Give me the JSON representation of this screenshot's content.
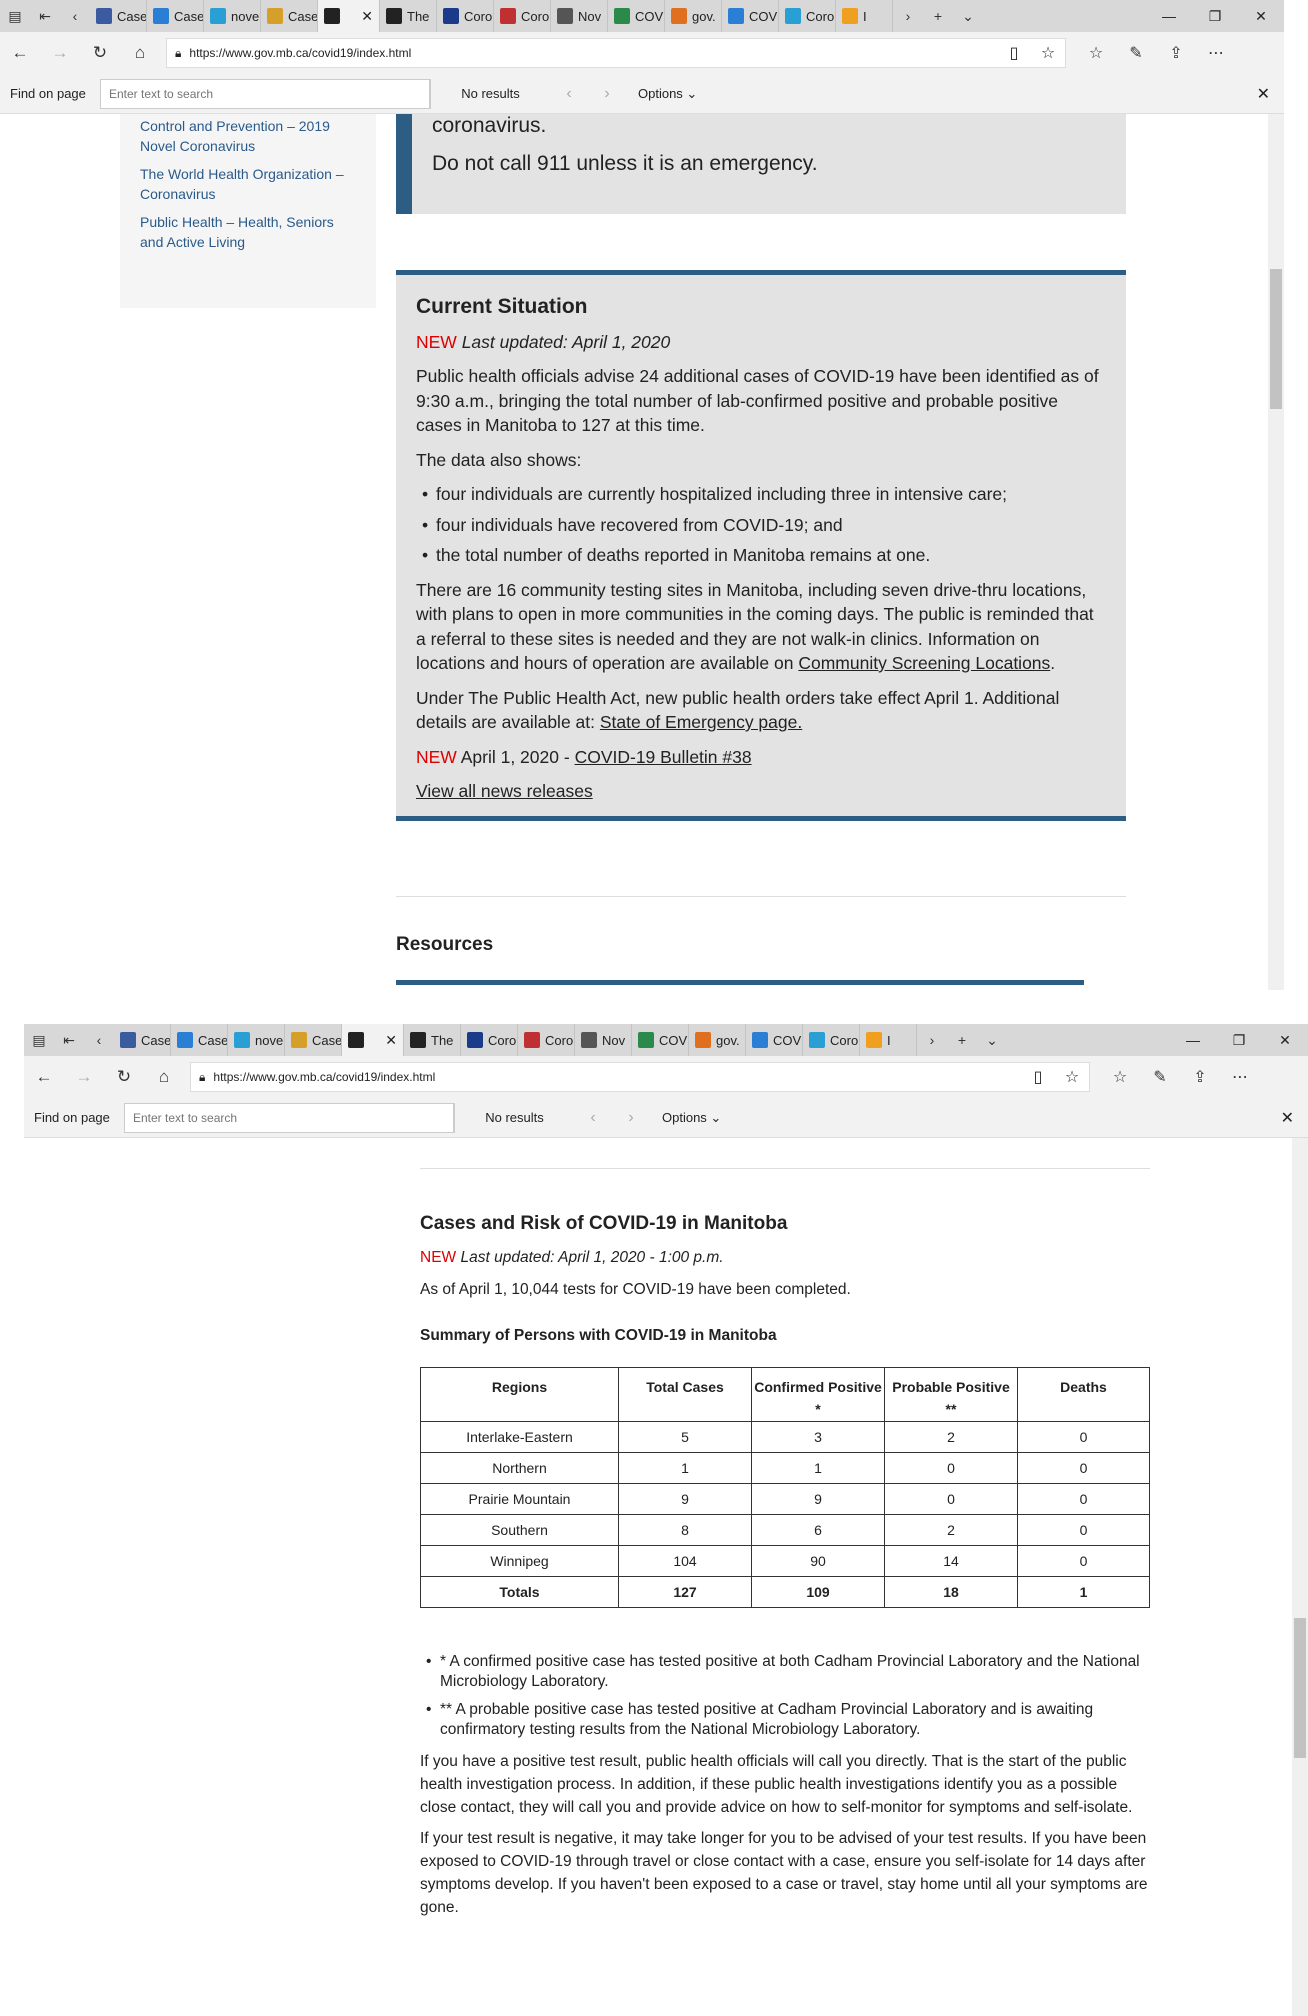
{
  "browser": {
    "tabs": [
      {
        "label": "Case",
        "icon": "cbc-icon",
        "color": "#3a5ba0"
      },
      {
        "label": "Case",
        "icon": "chart-icon",
        "color": "#2a7fd4"
      },
      {
        "label": "nove",
        "icon": "cross-icon",
        "color": "#2a9fd4"
      },
      {
        "label": "Case",
        "icon": "chart-icon",
        "color": "#d4a02a"
      },
      {
        "label": "",
        "icon": "arrow-icon",
        "color": "#222",
        "active": true
      },
      {
        "label": "The",
        "icon": "shield-icon",
        "color": "#222"
      },
      {
        "label": "Coro",
        "icon": "quebec-icon",
        "color": "#1a3a8a"
      },
      {
        "label": "Coro",
        "icon": "tool-icon",
        "color": "#c03030"
      },
      {
        "label": "Nov",
        "icon": "mail-icon",
        "color": "#555"
      },
      {
        "label": "COV",
        "icon": "arrow-icon",
        "color": "#2a8a4a"
      },
      {
        "label": "gov.",
        "icon": "maple-icon",
        "color": "#e07020"
      },
      {
        "label": "COV",
        "icon": "globe-icon",
        "color": "#2a7fd4"
      },
      {
        "label": "Coro",
        "icon": "cloud-icon",
        "color": "#2a9fd4"
      },
      {
        "label": "I",
        "icon": "sun-icon",
        "color": "#f0a020"
      }
    ],
    "url": "https://www.gov.mb.ca/covid19/index.html",
    "find_label": "Find on page",
    "find_placeholder": "Enter text to search",
    "find_results": "No results",
    "options_label": "Options"
  },
  "page1": {
    "sidebar_links": [
      "Control and Prevention – 2019 Novel Coronavirus",
      "The World Health Organization – Coronavirus",
      "Public Health – Health, Seniors and Active Living"
    ],
    "callout_lines": [
      "coronavirus.",
      "Do not call 911 unless it is an emergency."
    ],
    "situation": {
      "title": "Current Situation",
      "new_tag": "NEW",
      "updated": "Last updated: April 1, 2020",
      "p1": "Public health officials advise 24 additional cases of COVID-19 have been identified as of 9:30 a.m., bringing the total number of lab-confirmed positive and probable positive cases in Manitoba to 127 at this time.",
      "p2": "The data also shows:",
      "bullets": [
        "four individuals are currently hospitalized including three in intensive care;",
        "four individuals have recovered from COVID-19; and",
        "the total number of deaths reported in Manitoba remains at one."
      ],
      "p3": "There are 16 community testing sites in Manitoba, including seven drive-thru locations, with plans to open in more communities in the coming days. The public is reminded that a referral to these sites is needed and they are not walk-in clinics. Information on locations and hours of operation are available on",
      "p3_link": "Community Screening Locations",
      "p4": "Under The Public Health Act, new public health orders take effect April 1. Additional details are available at:",
      "p4_link": "State of Emergency page.",
      "bulletin_prefix": "April 1, 2020 -",
      "bulletin_link": "COVID-19 Bulletin #38",
      "all_news": "View all news releases"
    },
    "resources_title": "Resources"
  },
  "page2": {
    "title": "Cases and Risk of COVID-19 in Manitoba",
    "new_tag": "NEW",
    "updated": "Last updated: April 1, 2020 - 1:00 p.m.",
    "tests": "As of April 1, 10,044 tests for COVID-19 have been completed.",
    "table_title": "Summary of Persons with COVID-19 in Manitoba",
    "headers": [
      "Regions",
      "Total Cases",
      "Confirmed Positive *",
      "Probable Positive **",
      "Deaths"
    ],
    "rows": [
      [
        "Interlake-Eastern",
        "5",
        "3",
        "2",
        "0"
      ],
      [
        "Northern",
        "1",
        "1",
        "0",
        "0"
      ],
      [
        "Prairie Mountain",
        "9",
        "9",
        "0",
        "0"
      ],
      [
        "Southern",
        "8",
        "6",
        "2",
        "0"
      ],
      [
        "Winnipeg",
        "104",
        "90",
        "14",
        "0"
      ]
    ],
    "totals": [
      "Totals",
      "127",
      "109",
      "18",
      "1"
    ],
    "notes": [
      "* A confirmed positive case has tested positive at both Cadham Provincial Laboratory and the National Microbiology Laboratory.",
      "** A probable positive case has tested positive at Cadham Provincial Laboratory and is awaiting confirmatory testing results from the National Microbiology Laboratory."
    ],
    "para1": "If you have a positive test result, public health officials will call you directly. That is the start of the public health investigation process. In addition, if these public health investigations identify you as a possible close contact, they will call you and provide advice on how to self-monitor for symptoms and self-isolate.",
    "para2": "If your test result is negative, it may take longer for you to be advised of your test results. If you have been exposed to COVID-19 through travel or close contact with a case, ensure you self-isolate for 14 days after symptoms develop. If you haven't been exposed to a case or travel, stay home until all your symptoms are gone."
  }
}
